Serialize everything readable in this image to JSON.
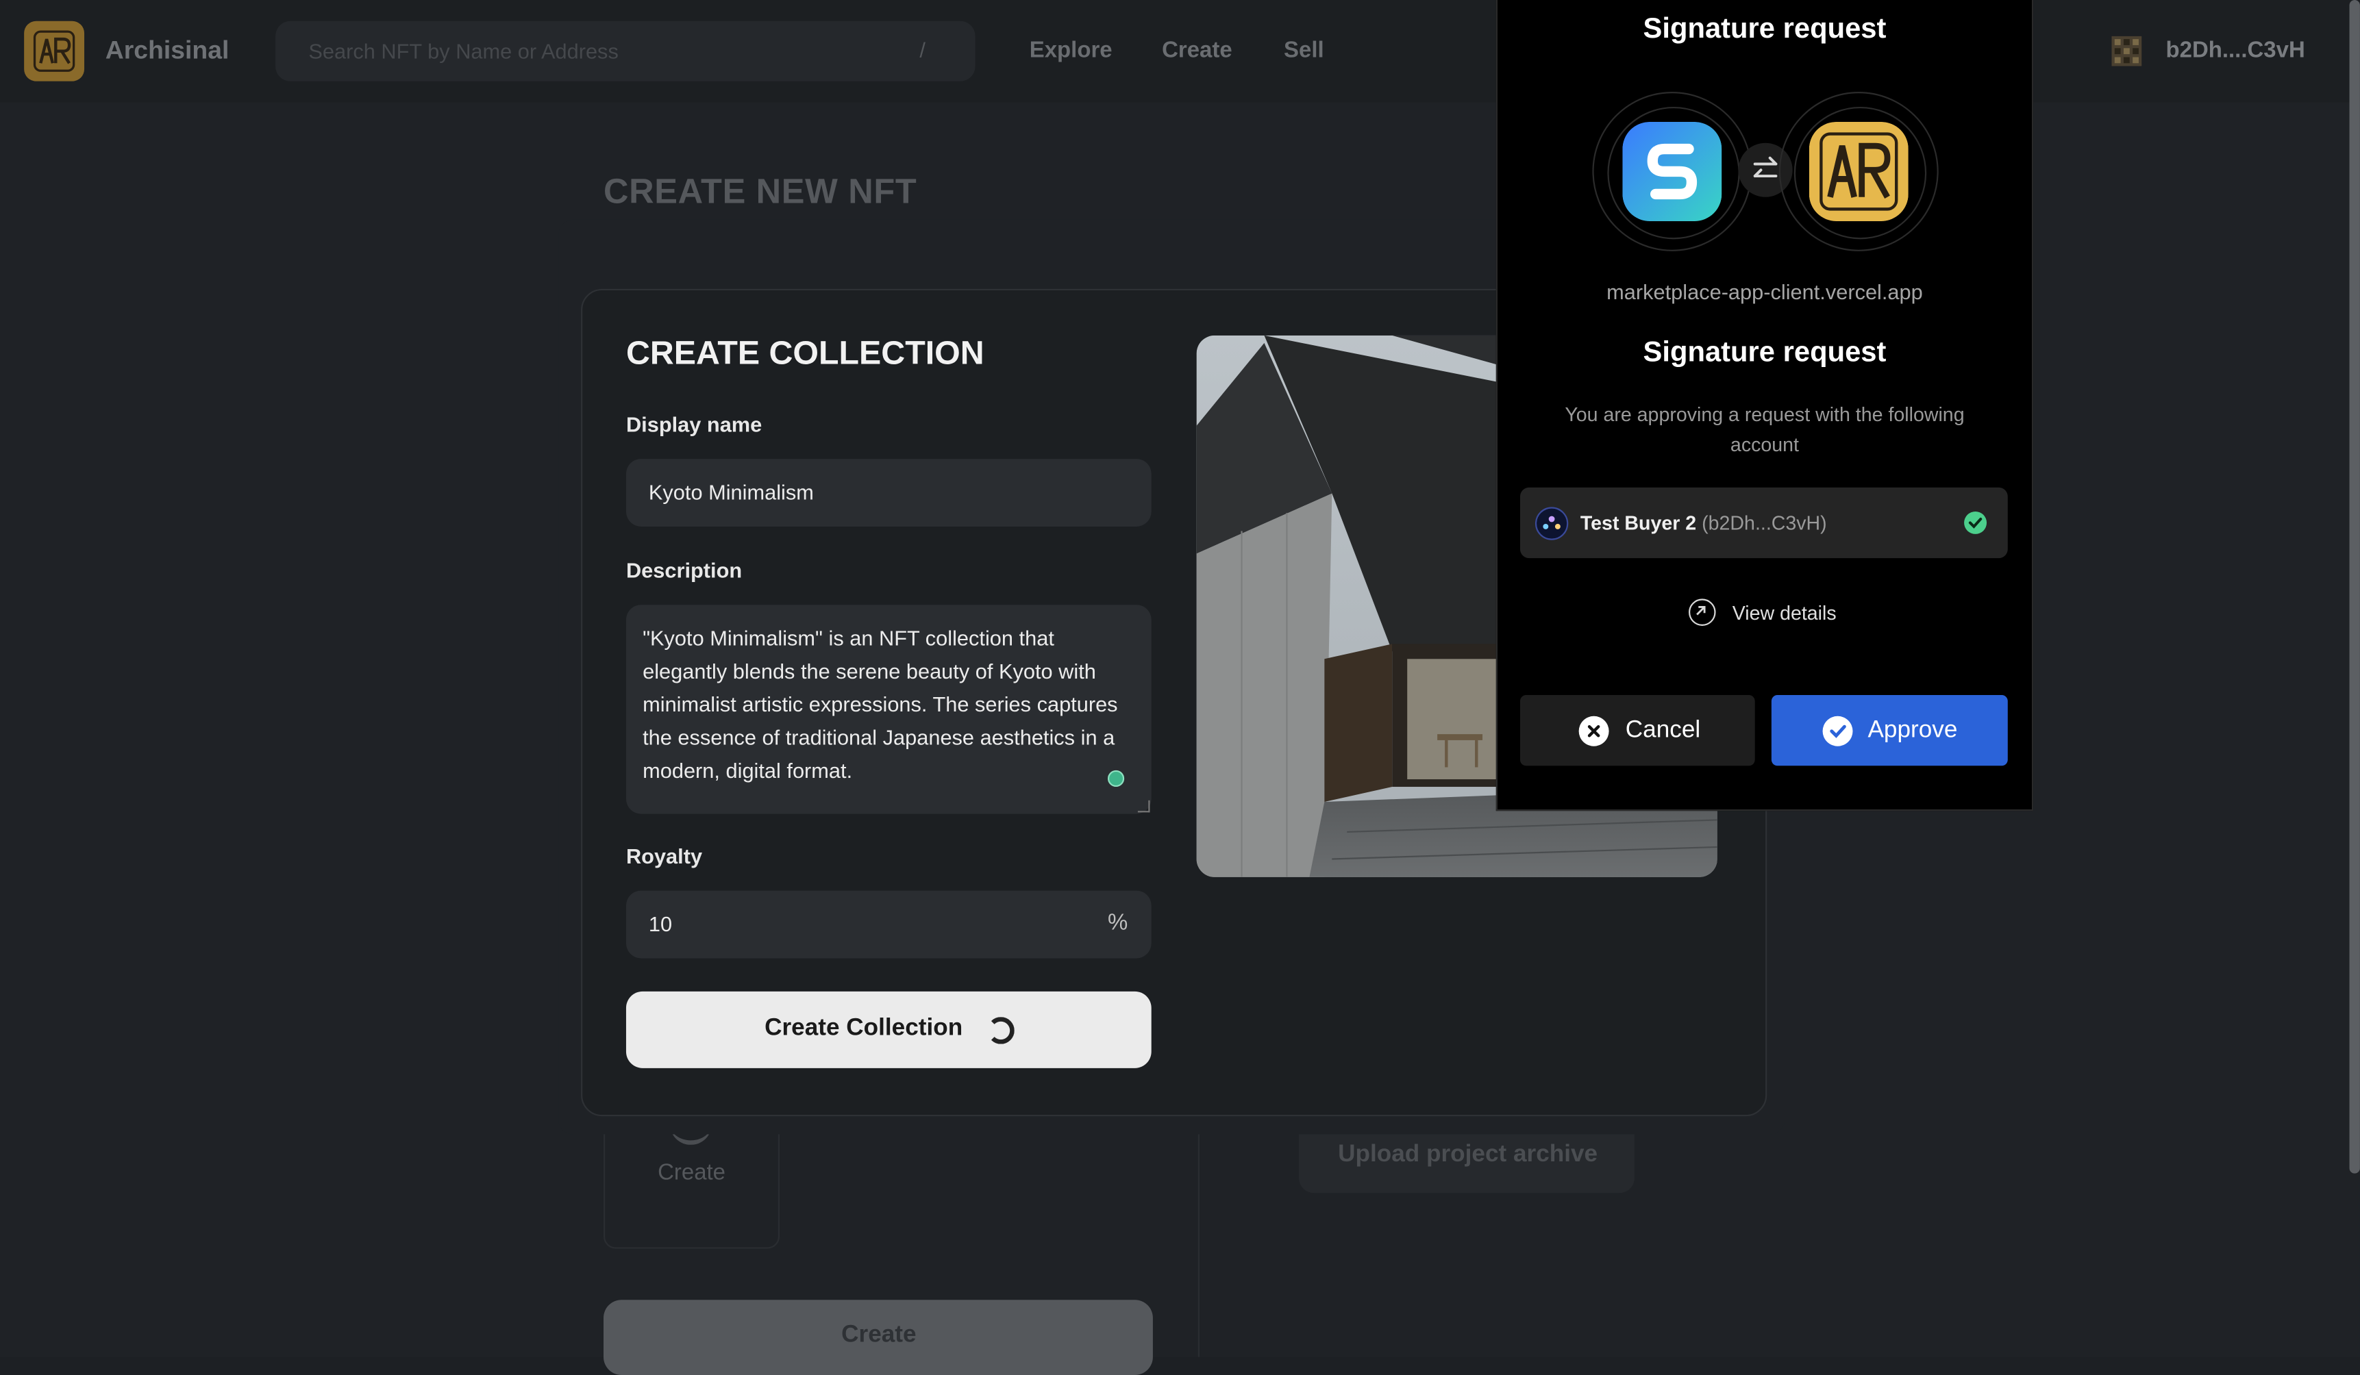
{
  "header": {
    "brand": "Archisinal",
    "search_placeholder": "Search NFT by Name or Address",
    "search_shortcut": "/",
    "nav": [
      "Explore",
      "Create",
      "Sell"
    ],
    "wallet_address": "b2Dh....C3vH"
  },
  "page": {
    "title": "CREATE NEW NFT",
    "step_label": "Create",
    "upload_label": "Upload project archive",
    "bottom_create_label": "Create"
  },
  "collection_form": {
    "title": "CREATE COLLECTION",
    "display_name_label": "Display name",
    "display_name_value": "Kyoto Minimalism",
    "description_label": "Description",
    "description_value": "\"Kyoto Minimalism\" is an NFT collection that elegantly blends the serene beauty of Kyoto with minimalist artistic expressions. The series captures the essence of traditional Japanese aesthetics in a modern, digital format.",
    "royalty_label": "Royalty",
    "royalty_value": "10",
    "royalty_unit": "%",
    "submit_label": "Create Collection"
  },
  "wallet_popup": {
    "header_title": "Signature request",
    "domain": "marketplace-app-client.vercel.app",
    "title": "Signature request",
    "description": "You are approving a request with the following account",
    "account_name": "Test Buyer 2",
    "account_address": "(b2Dh...C3vH)",
    "view_details_label": "View details",
    "cancel_label": "Cancel",
    "approve_label": "Approve",
    "colors": {
      "approve": "#2b63d9",
      "check": "#4ccf8c"
    }
  }
}
